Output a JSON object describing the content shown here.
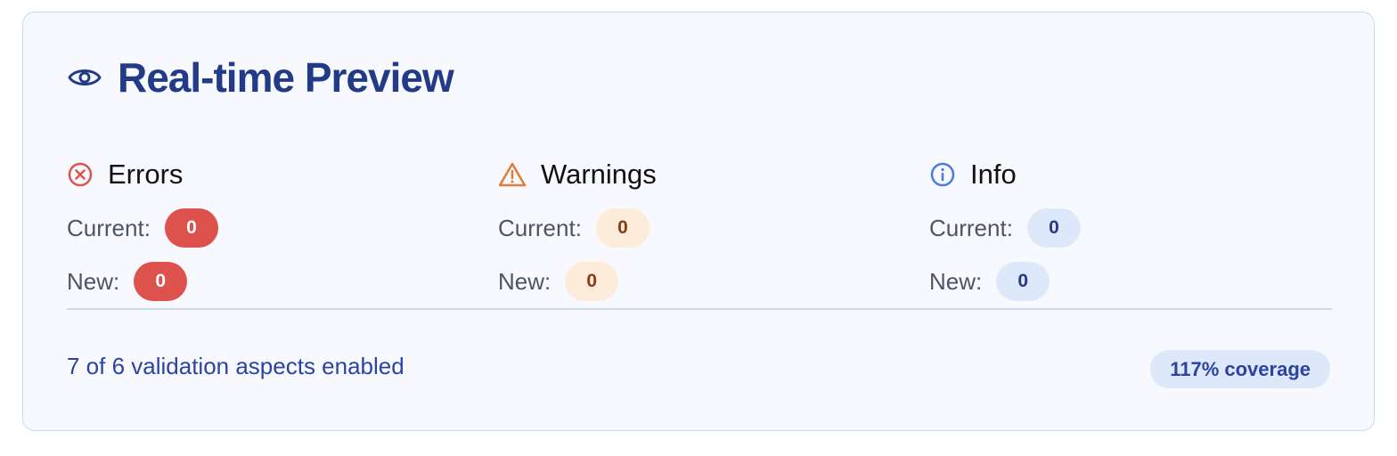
{
  "header": {
    "icon": "eye-icon",
    "title": "Real-time Preview"
  },
  "columns": [
    {
      "title": "Errors",
      "icon": "x-circle-icon",
      "color": "#dd524c",
      "current_label": "Current:",
      "current_value": "0",
      "new_label": "New:",
      "new_value": "0"
    },
    {
      "title": "Warnings",
      "icon": "warning-triangle-icon",
      "color": "#e07b3a",
      "current_label": "Current:",
      "current_value": "0",
      "new_label": "New:",
      "new_value": "0"
    },
    {
      "title": "Info",
      "icon": "info-circle-icon",
      "color": "#4a7be0",
      "current_label": "Current:",
      "current_value": "0",
      "new_label": "New:",
      "new_value": "0"
    }
  ],
  "footer": {
    "summary": "7 of 6 validation aspects enabled",
    "coverage": "117% coverage"
  }
}
